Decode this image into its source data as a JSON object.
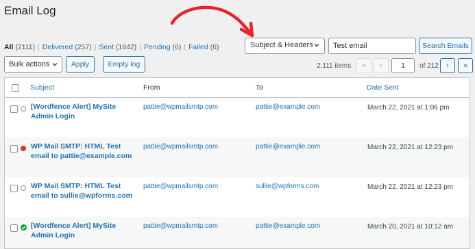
{
  "page": {
    "title": "Email Log"
  },
  "filters": [
    {
      "label": "All",
      "count": "(2111)",
      "current": true
    },
    {
      "label": "Delivered",
      "count": "(257)",
      "current": false
    },
    {
      "label": "Sent",
      "count": "(1842)",
      "current": false
    },
    {
      "label": "Pending",
      "count": "(6)",
      "current": false
    },
    {
      "label": "Failed",
      "count": "(6)",
      "current": false
    }
  ],
  "search": {
    "field_select": "Subject & Headers",
    "query": "Test email",
    "button": "Search Emails"
  },
  "bulk": {
    "select": "Bulk actions",
    "apply": "Apply",
    "empty": "Empty log"
  },
  "pagination": {
    "items": "2,111 items",
    "first": "«",
    "prev": "‹",
    "current_page": "1",
    "of_total": "of 212",
    "next": "›",
    "last": "»"
  },
  "table": {
    "headers": {
      "subject": "Subject",
      "from": "From",
      "to": "To",
      "date": "Date Sent"
    },
    "rows": [
      {
        "status": "unknown",
        "subject": "[Wordfence Alert] MySite Admin Login",
        "from": "pattie@wpmailsmtp.com",
        "to": "pattie@example.com",
        "date": "March 22, 2021 at 1:06 pm"
      },
      {
        "status": "failed",
        "subject": "WP Mail SMTP: HTML Test email to pattie@example.com",
        "from": "pattie@wpmailsmtp.com",
        "to": "pattie@example.com",
        "date": "March 22, 2021 at 12:23 pm"
      },
      {
        "status": "unknown",
        "subject": "WP Mail SMTP: HTML Test email to sullie@wpforms.com",
        "from": "pattie@wpmailsmtp.com",
        "to": "sullie@wpforms.com",
        "date": "March 22, 2021 at 12:23 pm"
      },
      {
        "status": "delivered",
        "subject": "[Wordfence Alert] MySite Admin Login",
        "from": "pattie@wpmailsmtp.com",
        "to": "pattie@example.com",
        "date": "March 20, 2021 at 10:12 am"
      }
    ]
  },
  "colors": {
    "link": "#2271b1",
    "failed": "#d63638",
    "delivered": "#00a32a",
    "annotation_arrow": "#e8232a"
  }
}
